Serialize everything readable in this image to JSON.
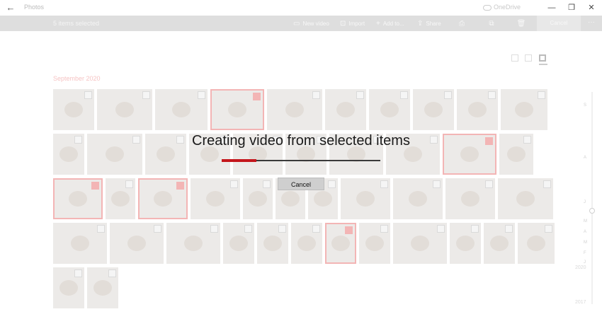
{
  "titlebar": {
    "app_title": "Photos",
    "onedrive": "OneDrive",
    "minimize": "—",
    "restore": "❐",
    "close": "✕",
    "back": "←"
  },
  "toolbar": {
    "selected_count": "5 items selected",
    "new_video": "New video",
    "import": "Import",
    "add_to": "Add to...",
    "share": "Share",
    "cancel": "Cancel",
    "more": "···"
  },
  "gallery": {
    "month": "September 2020"
  },
  "timeline": {
    "ticks": [
      "S",
      "A",
      "J",
      "M",
      "A",
      "M",
      "F",
      "J"
    ],
    "years": [
      "2020",
      "2017"
    ]
  },
  "dialog": {
    "title": "Creating video from selected items",
    "progress_fraction": 0.22,
    "cancel": "Cancel",
    "accent": "#c4161c"
  },
  "selected_photos": [
    [
      0,
      3
    ],
    [
      1,
      8
    ],
    [
      2,
      0
    ],
    [
      2,
      2
    ],
    [
      3,
      6
    ]
  ]
}
